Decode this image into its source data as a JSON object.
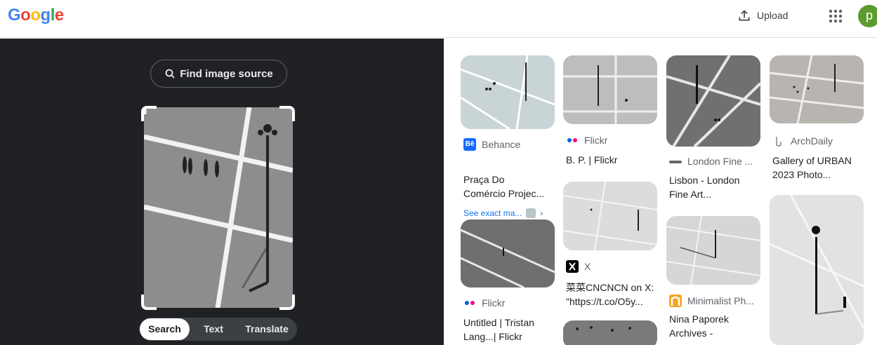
{
  "header": {
    "logo": "Google",
    "upload_label": "Upload",
    "avatar_letter": "p"
  },
  "left": {
    "find_source_label": "Find image source",
    "modes": [
      "Search",
      "Text",
      "Translate"
    ]
  },
  "results": [
    {
      "source": "Behance",
      "title_line1": "Praça Do",
      "title_line2": "Comércio Projec...",
      "exact": "See exact ma...",
      "icon": "behance-icon"
    },
    {
      "source": "Flickr",
      "title_line1": "B. P. | Flickr",
      "icon": "flickr-icon"
    },
    {
      "source": "London Fine ...",
      "title_line1": "Lisbon - London",
      "title_line2": "Fine Art...",
      "icon": "london-fine-art-icon"
    },
    {
      "source": "ArchDaily",
      "title_line1": "Gallery of URBAN",
      "title_line2": "2023 Photo...",
      "icon": "archdaily-icon"
    },
    {
      "source": "Flickr",
      "title_line1": "Untitled | Tristan",
      "title_line2": "Lang...| Flickr",
      "icon": "flickr-icon"
    },
    {
      "source": "X",
      "title_line1": "菜菜CNCNCN on X:",
      "title_line2": "\"https://t.co/O5y...",
      "icon": "x-icon"
    },
    {
      "source": "Minimalist Ph...",
      "title_line1": "Nina Paporek",
      "title_line2": "Archives -",
      "icon": "minimalist-icon"
    }
  ],
  "colors": {
    "left_bg": "#202124",
    "link": "#1a73e8",
    "avatar": "#5c9b2e"
  }
}
